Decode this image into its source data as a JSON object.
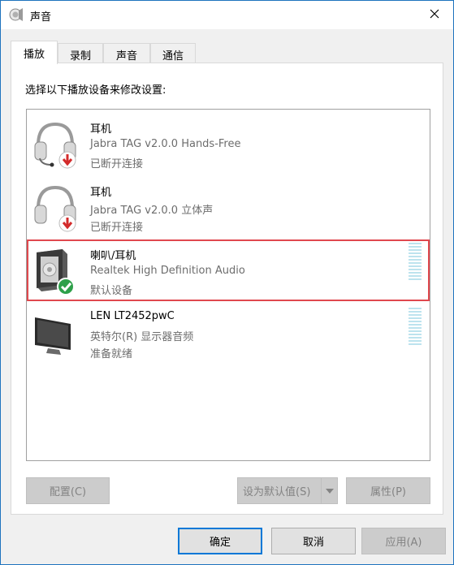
{
  "window": {
    "title": "声音",
    "accent_color": "#1e73be"
  },
  "tabs": [
    {
      "label": "播放",
      "active": true
    },
    {
      "label": "录制",
      "active": false
    },
    {
      "label": "声音",
      "active": false
    },
    {
      "label": "通信",
      "active": false
    }
  ],
  "panel": {
    "instruction": "选择以下播放设备来修改设置:"
  },
  "devices": [
    {
      "name": "耳机",
      "description": "Jabra TAG v2.0.0 Hands-Free",
      "status": "已断开连接",
      "icon": "headset-icon",
      "badge": "disconnected-arrow-icon",
      "selected": false
    },
    {
      "name": "耳机",
      "description": "Jabra TAG v2.0.0 立体声",
      "status": "已断开连接",
      "icon": "headphones-icon",
      "badge": "disconnected-arrow-icon",
      "selected": false
    },
    {
      "name": "喇叭/耳机",
      "description": "Realtek High Definition Audio",
      "status": "默认设备",
      "icon": "speaker-icon",
      "badge": "default-check-icon",
      "selected": true
    },
    {
      "name": "LEN LT2452pwC",
      "description": "英特尔(R) 显示器音频",
      "status": "准备就绪",
      "icon": "monitor-icon",
      "badge": "",
      "selected": false
    }
  ],
  "buttons": {
    "configure": "配置(C)",
    "set_default": "设为默认值(S)",
    "properties": "属性(P)",
    "ok": "确定",
    "cancel": "取消",
    "apply": "应用(A)"
  },
  "colors": {
    "selection_border": "#e0484e",
    "check_badge": "#2ea04a",
    "disconnect_badge": "#d32b2b",
    "default_button_border": "#0078d7"
  }
}
